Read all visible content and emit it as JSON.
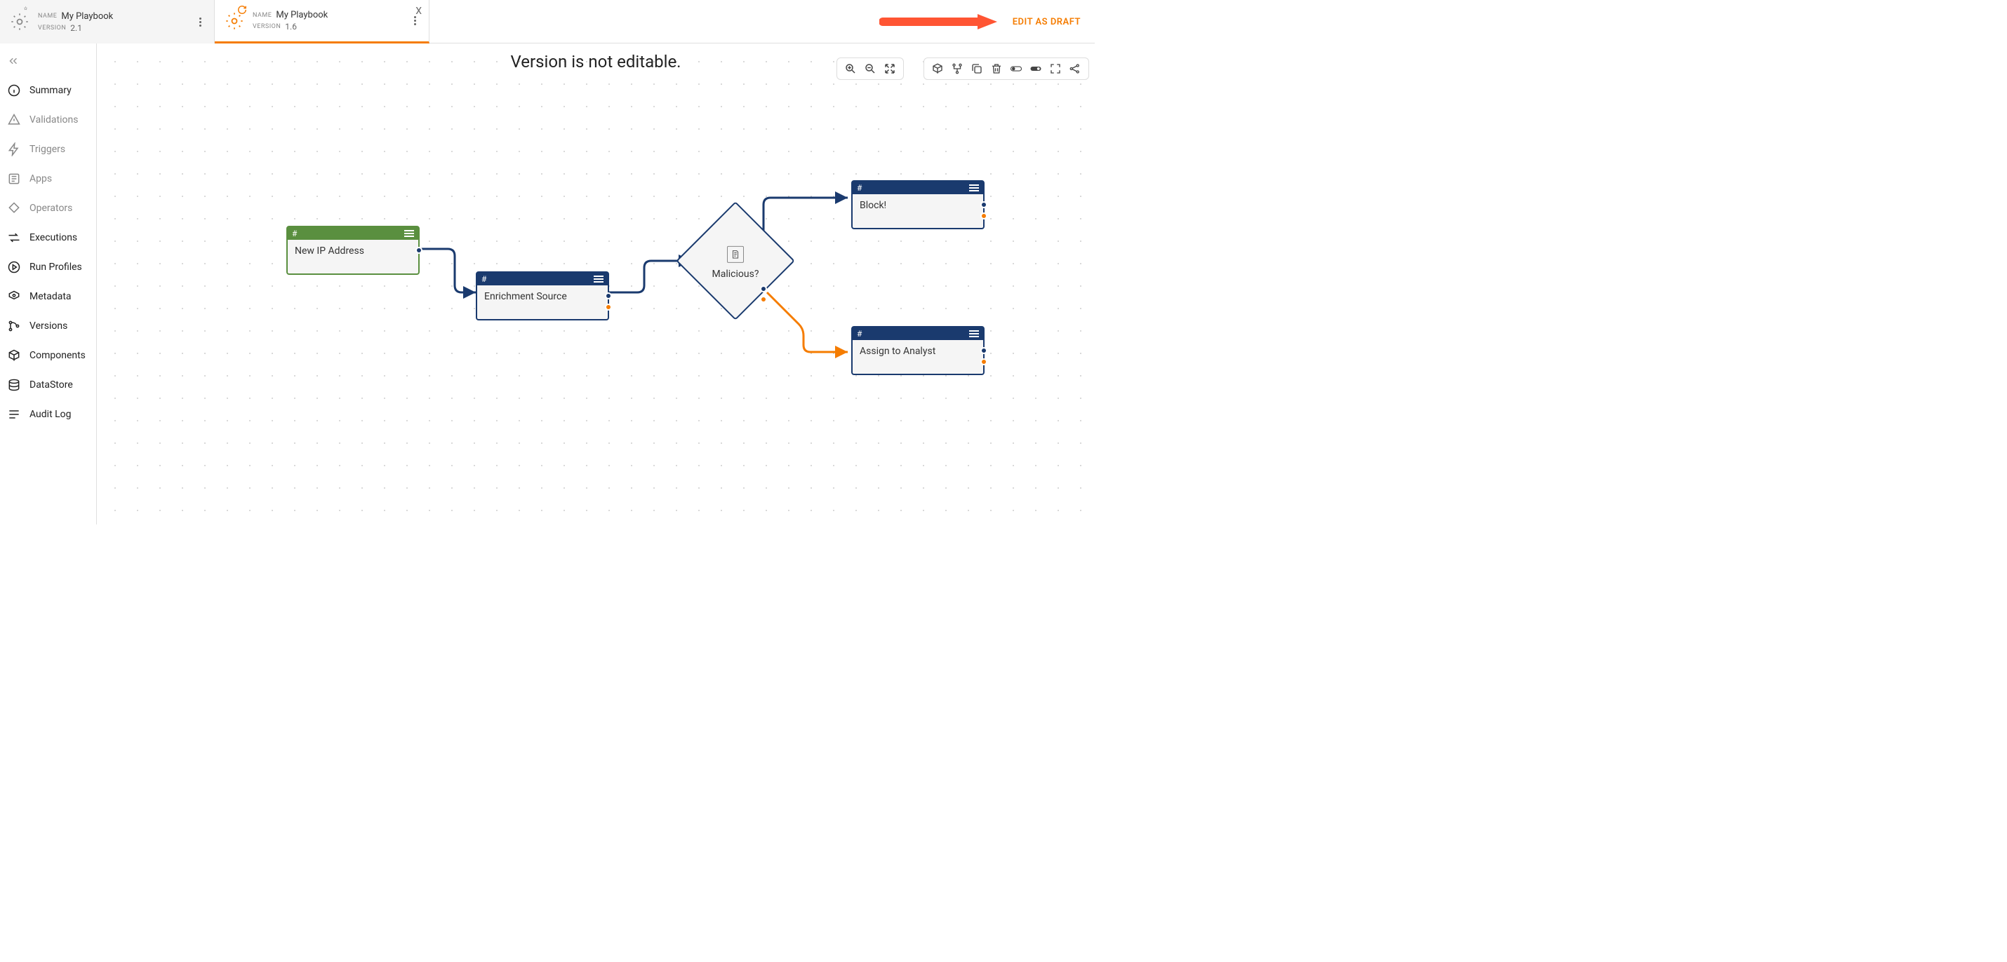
{
  "tabs": [
    {
      "name_label": "NAME",
      "name": "My Playbook",
      "version_label": "VERSION",
      "version": "2.1"
    },
    {
      "name_label": "NAME",
      "name": "My Playbook",
      "version_label": "VERSION",
      "version": "1.6"
    }
  ],
  "header": {
    "edit_draft": "EDIT AS DRAFT"
  },
  "banner": "Version is not editable.",
  "sidebar": {
    "items": [
      {
        "label": "Summary"
      },
      {
        "label": "Validations"
      },
      {
        "label": "Triggers"
      },
      {
        "label": "Apps"
      },
      {
        "label": "Operators"
      },
      {
        "label": "Executions"
      },
      {
        "label": "Run Profiles"
      },
      {
        "label": "Metadata"
      },
      {
        "label": "Versions"
      },
      {
        "label": "Components"
      },
      {
        "label": "DataStore"
      },
      {
        "label": "Audit Log"
      }
    ]
  },
  "nodes": {
    "n1": {
      "hash": "#",
      "label": "New IP Address"
    },
    "n2": {
      "hash": "#",
      "label": "Enrichment Source"
    },
    "n3": {
      "label": "Malicious?"
    },
    "n4": {
      "hash": "#",
      "label": "Block!"
    },
    "n5": {
      "hash": "#",
      "label": "Assign to Analyst"
    }
  }
}
